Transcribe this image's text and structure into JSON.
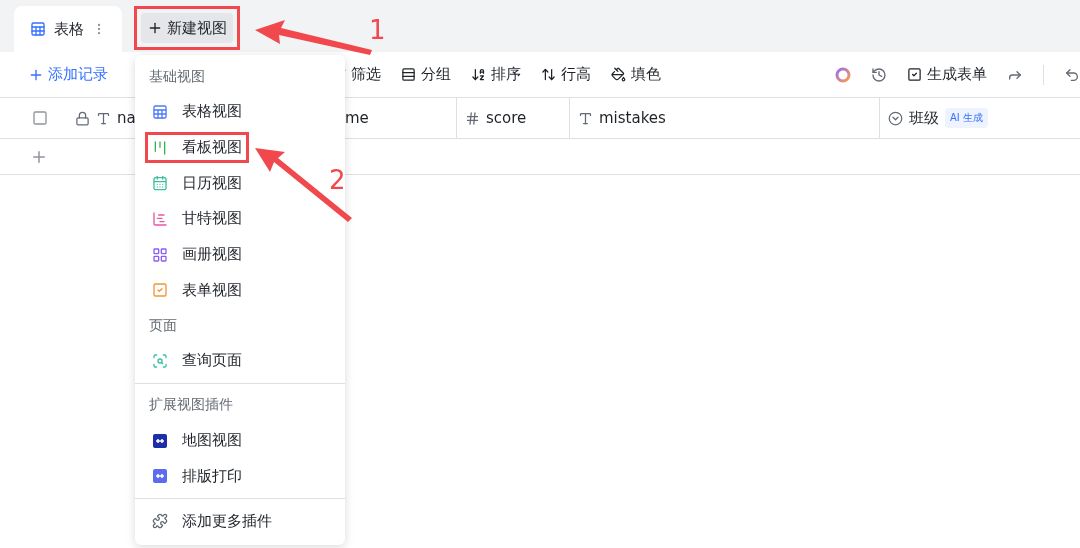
{
  "tabs": [
    {
      "label": "表格",
      "selected": true
    }
  ],
  "new_view_button": {
    "label": "新建视图",
    "annotated": true
  },
  "toolbar": {
    "add_record": "添加记录",
    "tools": [
      {
        "kind": "filter",
        "label": "筛选"
      },
      {
        "kind": "group",
        "label": "分组"
      },
      {
        "kind": "sort",
        "label": "排序"
      },
      {
        "kind": "height",
        "label": "行高"
      },
      {
        "kind": "fill",
        "label": "填色"
      }
    ],
    "generate_form": "生成表单"
  },
  "table": {
    "select_all": {
      "checked": false
    },
    "columns": [
      {
        "kind": "name",
        "label": "na"
      },
      {
        "kind": "plain",
        "label": "me"
      },
      {
        "kind": "number",
        "label": "score"
      },
      {
        "kind": "text",
        "label": "mistakes"
      },
      {
        "kind": "select",
        "label": "班级",
        "badge": "AI 生成"
      }
    ]
  },
  "menu": {
    "sections": [
      {
        "title": "基础视图",
        "items": [
          {
            "label": "表格视图",
            "kind": "grid",
            "annotated": false
          },
          {
            "label": "看板视图",
            "kind": "kanban",
            "annotated": true
          },
          {
            "label": "日历视图",
            "kind": "calendar",
            "annotated": false
          },
          {
            "label": "甘特视图",
            "kind": "gantt",
            "annotated": false
          },
          {
            "label": "画册视图",
            "kind": "gallery",
            "annotated": false
          },
          {
            "label": "表单视图",
            "kind": "form",
            "annotated": false
          }
        ]
      },
      {
        "title": "页面",
        "items": [
          {
            "label": "查询页面",
            "kind": "query",
            "annotated": false
          }
        ]
      },
      {
        "title": "扩展视图插件",
        "items": [
          {
            "label": "地图视图",
            "kind": "map",
            "annotated": false
          },
          {
            "label": "排版打印",
            "kind": "print",
            "annotated": false
          }
        ]
      }
    ],
    "footer": "添加更多插件"
  },
  "annotations": [
    {
      "label": "1"
    },
    {
      "label": "2"
    }
  ]
}
